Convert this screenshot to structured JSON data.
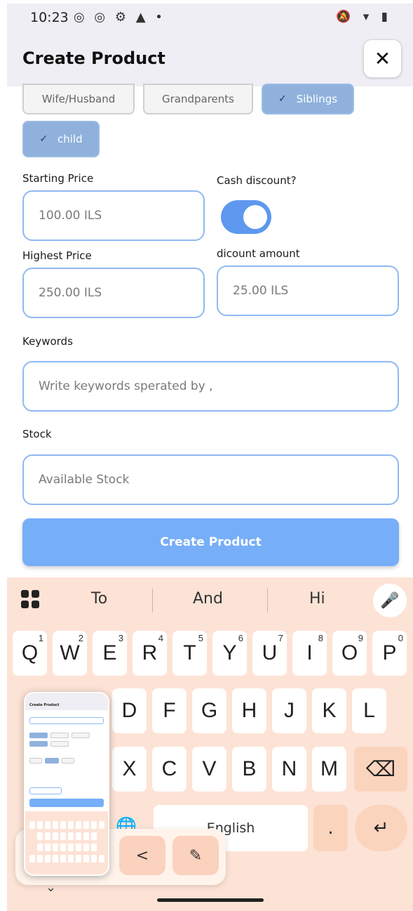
{
  "status_bar": {
    "time": "10:23",
    "left_icons": "◎ ◎ ⚙ ▲ •",
    "right_icons": "🔕 ▾ ▮"
  },
  "header": {
    "title": "Create Product",
    "close_label": "✕"
  },
  "chips": {
    "wife_husband": "Wife/Husband",
    "grandparents": "Grandparents",
    "siblings": "Siblings",
    "child": "child",
    "check": "✓"
  },
  "form": {
    "starting_price_label": "Starting Price",
    "starting_price_placeholder": "100.00 ILS",
    "cash_discount_label": "Cash discount?",
    "cash_discount_on": true,
    "highest_price_label": "Highest Price",
    "highest_price_placeholder": "250.00 ILS",
    "discount_amount_label": "dicount amount",
    "discount_amount_placeholder": "25.00 ILS",
    "keywords_label": "Keywords",
    "keywords_placeholder": "Write keywords sperated by ,",
    "stock_label": "Stock",
    "stock_placeholder": "Available Stock",
    "submit_label": "Create Product"
  },
  "keyboard": {
    "suggestions": [
      "To",
      "And",
      "Hi"
    ],
    "row1": [
      {
        "k": "Q",
        "n": "1"
      },
      {
        "k": "W",
        "n": "2"
      },
      {
        "k": "E",
        "n": "3"
      },
      {
        "k": "R",
        "n": "4"
      },
      {
        "k": "T",
        "n": "5"
      },
      {
        "k": "Y",
        "n": "6"
      },
      {
        "k": "U",
        "n": "7"
      },
      {
        "k": "I",
        "n": "8"
      },
      {
        "k": "O",
        "n": "9"
      },
      {
        "k": "P",
        "n": "0"
      }
    ],
    "row2": [
      "D",
      "F",
      "G",
      "H",
      "J",
      "K",
      "L"
    ],
    "row3": [
      "X",
      "C",
      "V",
      "B",
      "N",
      "M"
    ],
    "space_label": "English",
    "period": ".",
    "enter": "↵",
    "backspace": "⌫",
    "globe": "🌐",
    "mic": "🎤"
  },
  "screenshot_tray": {
    "share_icon": "<",
    "edit_icon": "✎"
  },
  "colors": {
    "accent": "#77aef8",
    "field_border": "#8fb9f2",
    "chip_selected": "#8fb1dc",
    "keyboard_bg": "#fde3d6",
    "toggle_on": "#5d98ee"
  }
}
